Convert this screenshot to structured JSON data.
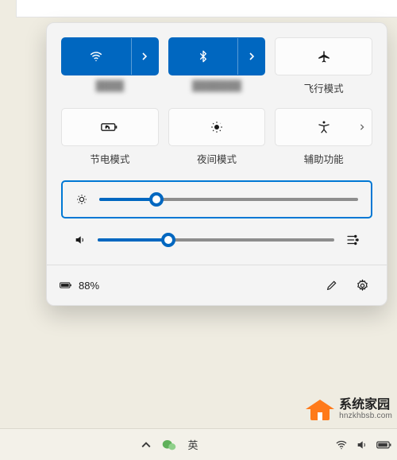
{
  "tiles": {
    "wifi": {
      "label": "",
      "active": true,
      "split": true
    },
    "bluetooth": {
      "label": "",
      "active": true,
      "split": true
    },
    "airplane": {
      "label": "飞行模式",
      "active": false,
      "split": false
    },
    "battery_saver": {
      "label": "节电模式",
      "active": false,
      "split": false
    },
    "night_light": {
      "label": "夜间模式",
      "active": false,
      "split": false
    },
    "accessibility": {
      "label": "辅助功能",
      "active": false,
      "split": false,
      "expand": true
    }
  },
  "sliders": {
    "brightness": {
      "value": 22
    },
    "volume": {
      "value": 30
    }
  },
  "footer": {
    "battery_text": "88%"
  },
  "taskbar": {
    "ime": "英"
  },
  "watermark": {
    "title": "系统家园",
    "url": "hnzkhbsb.com"
  }
}
